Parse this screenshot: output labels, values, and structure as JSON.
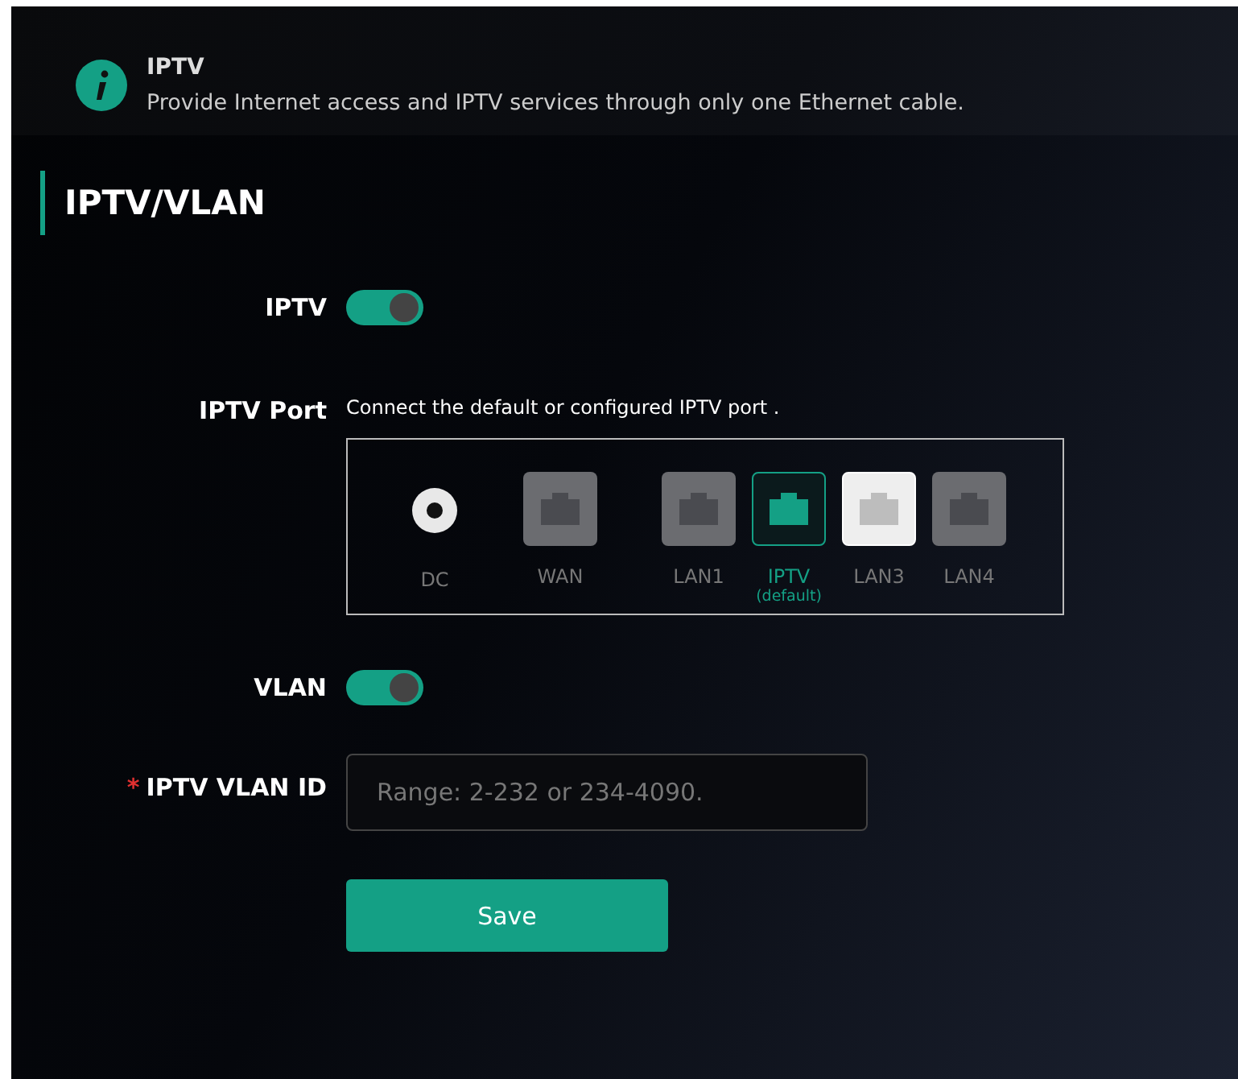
{
  "notice": {
    "title": "IPTV",
    "text": "Provide Internet access and IPTV services through only one Ethernet cable."
  },
  "section_title": "IPTV/VLAN",
  "iptv": {
    "label": "IPTV",
    "on": true
  },
  "iptv_port": {
    "label": "IPTV Port",
    "hint": "Connect the default or configured IPTV port .",
    "ports": [
      {
        "kind": "dc",
        "label": "DC"
      },
      {
        "kind": "ethernet",
        "label": "WAN",
        "selected": false,
        "highlighted": false
      },
      {
        "kind": "ethernet",
        "label": "LAN1",
        "selected": false,
        "highlighted": false
      },
      {
        "kind": "ethernet",
        "label": "IPTV",
        "sublabel": "(default)",
        "selected": true,
        "highlighted": false
      },
      {
        "kind": "ethernet",
        "label": "LAN3",
        "selected": false,
        "highlighted": true
      },
      {
        "kind": "ethernet",
        "label": "LAN4",
        "selected": false,
        "highlighted": false
      }
    ]
  },
  "vlan": {
    "label": "VLAN",
    "on": true
  },
  "vlan_id": {
    "label": "IPTV VLAN ID",
    "required_mark": "*",
    "placeholder": "Range: 2-232 or 234-4090."
  },
  "save_button": "Save"
}
